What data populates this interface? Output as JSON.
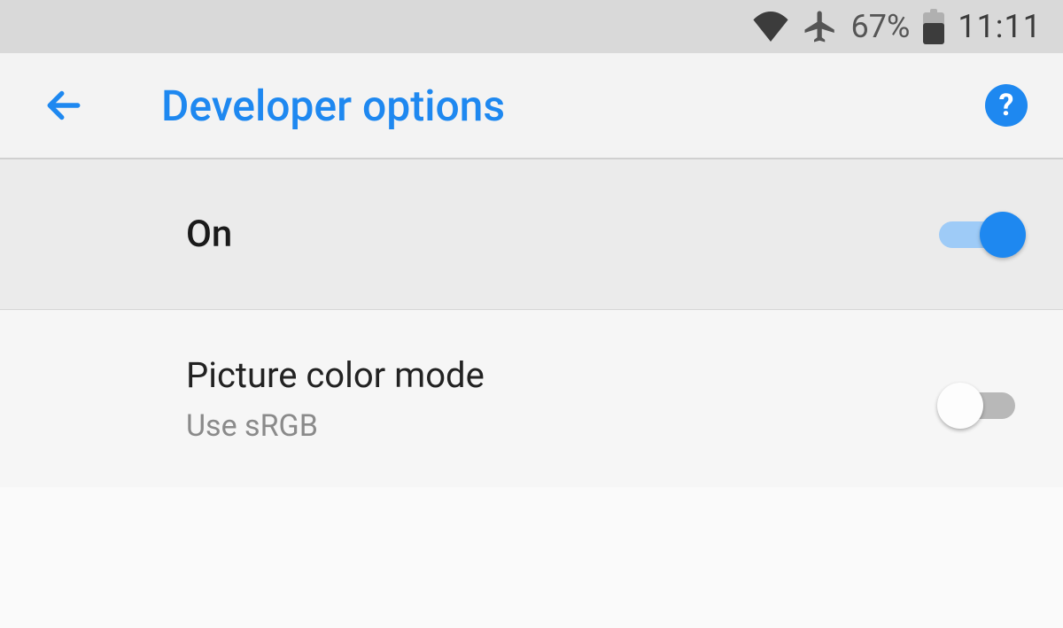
{
  "status_bar": {
    "battery_pct": "67%",
    "time": "11:11"
  },
  "app_bar": {
    "title": "Developer options"
  },
  "master_toggle": {
    "label": "On",
    "state": "on"
  },
  "settings": [
    {
      "title": "Picture color mode",
      "subtitle": "Use sRGB",
      "state": "off"
    }
  ],
  "colors": {
    "accent": "#1e88f0"
  }
}
